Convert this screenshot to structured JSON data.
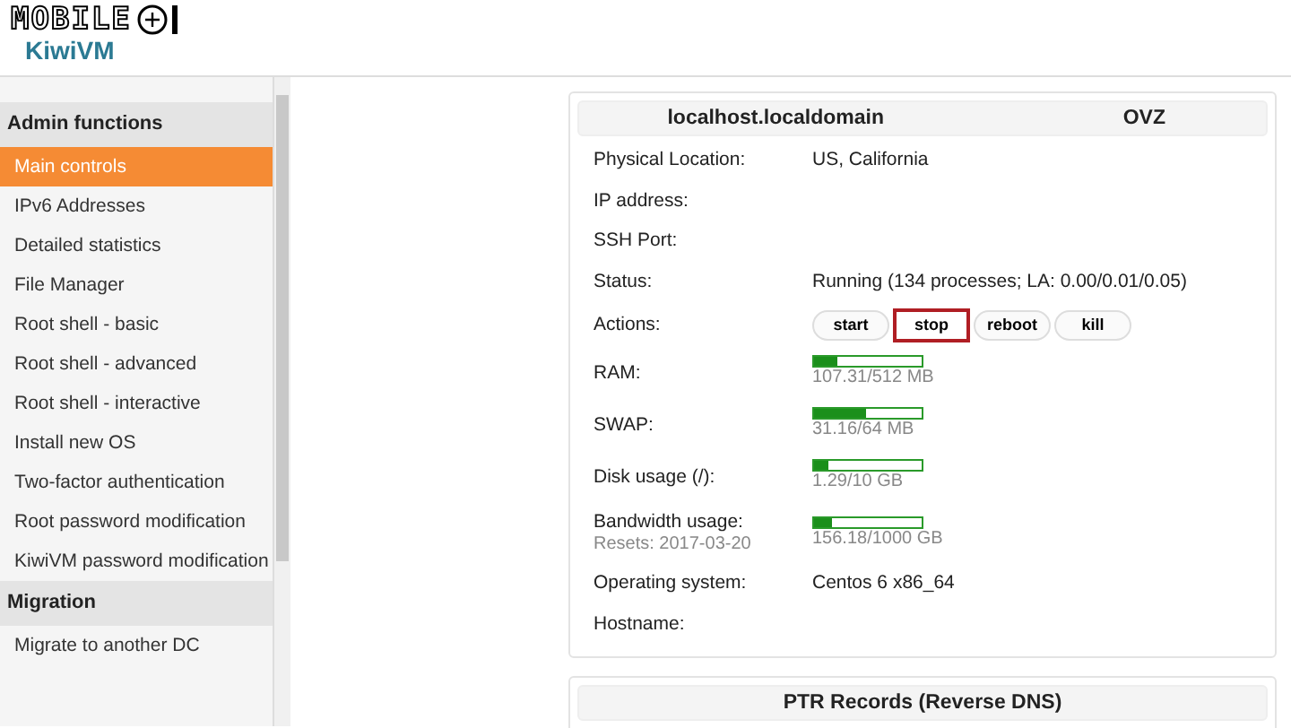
{
  "logo": {
    "brand": "MOBILE",
    "product": "KiwiVM"
  },
  "sidebar": {
    "sections": [
      {
        "title": "Admin functions",
        "items": [
          {
            "label": "Main controls",
            "selected": true
          },
          {
            "label": "IPv6 Addresses",
            "selected": false
          },
          {
            "label": "Detailed statistics",
            "selected": false
          },
          {
            "label": "File Manager",
            "selected": false
          },
          {
            "label": "Root shell - basic",
            "selected": false
          },
          {
            "label": "Root shell - advanced",
            "selected": false
          },
          {
            "label": "Root shell - interactive",
            "selected": false
          },
          {
            "label": "Install new OS",
            "selected": false
          },
          {
            "label": "Two-factor authentication",
            "selected": false
          },
          {
            "label": "Root password modification",
            "selected": false
          },
          {
            "label": "KiwiVM password modification",
            "selected": false
          }
        ]
      },
      {
        "title": "Migration",
        "items": [
          {
            "label": "Migrate to another DC",
            "selected": false
          }
        ]
      }
    ]
  },
  "server_card": {
    "hostname": "localhost.localdomain",
    "type": "OVZ",
    "rows": [
      {
        "kind": "text",
        "label": "Physical Location:",
        "value": "US, California"
      },
      {
        "kind": "text",
        "label": "IP address:"
      },
      {
        "kind": "text",
        "label": "SSH Port:"
      },
      {
        "kind": "text",
        "label": "Status:",
        "value": "Running (134 processes; LA: 0.00/0.01/0.05)"
      },
      {
        "kind": "actions",
        "label": "Actions:",
        "buttons": [
          {
            "label": "start",
            "highlighted": false
          },
          {
            "label": "stop",
            "highlighted": true
          },
          {
            "label": "reboot",
            "highlighted": false
          },
          {
            "label": "kill",
            "highlighted": false
          }
        ]
      },
      {
        "kind": "meter",
        "label": "RAM:",
        "level": 0.21,
        "reading": "107.31/512 MB"
      },
      {
        "kind": "meter",
        "label": "SWAP:",
        "level": 0.49,
        "reading": "31.16/64 MB"
      },
      {
        "kind": "meter",
        "label": "Disk usage (/):",
        "level": 0.13,
        "reading": "1.29/10 GB"
      },
      {
        "kind": "meter",
        "label": "Bandwidth usage:",
        "note": "Resets: 2017-03-20",
        "level": 0.16,
        "reading": "156.18/1000 GB"
      },
      {
        "kind": "text",
        "label": "Operating system:",
        "value": "Centos 6 x86_64"
      },
      {
        "kind": "text",
        "label": "Hostname:"
      }
    ]
  },
  "ptr_card": {
    "title": "PTR Records (Reverse DNS)"
  }
}
